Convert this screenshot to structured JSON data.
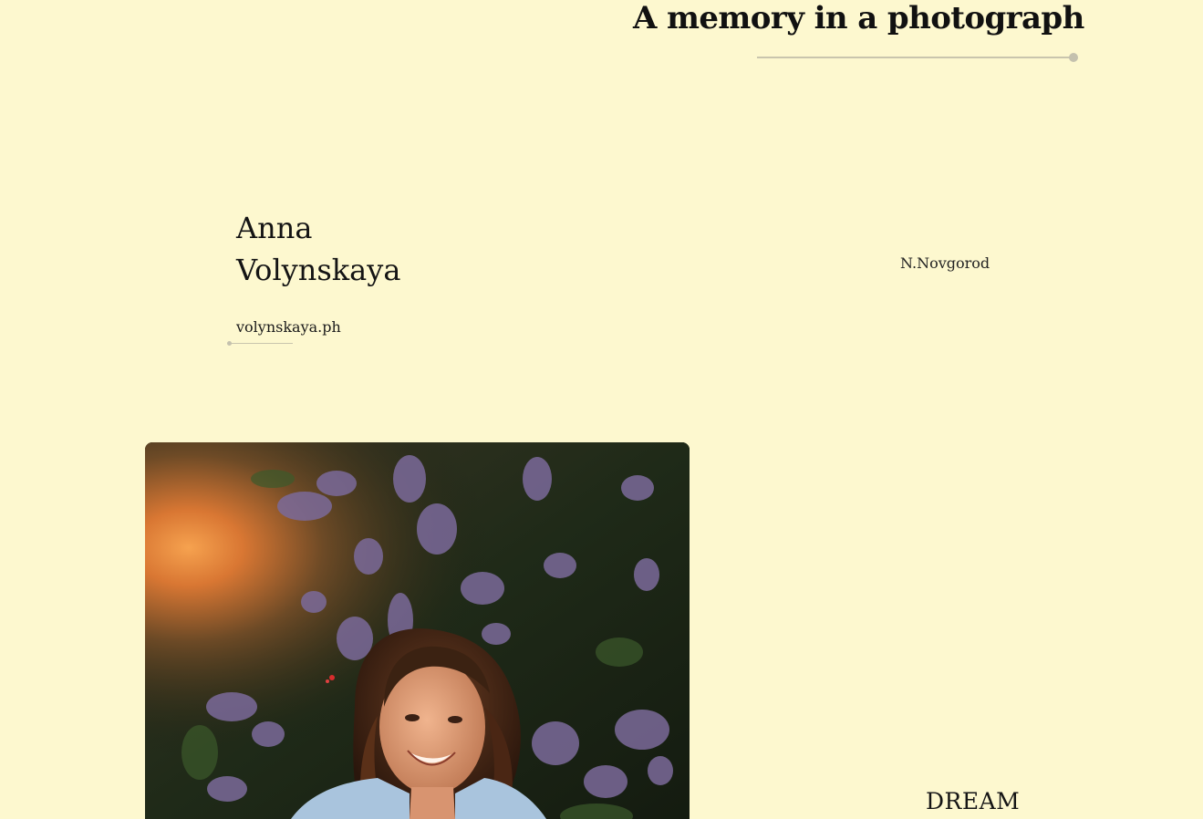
{
  "header": {
    "title": "A memory in a photograph"
  },
  "author": {
    "first_name": "Anna",
    "last_name": "Volynskaya",
    "handle": "volynskaya.ph",
    "city": "N.Novgorod"
  },
  "photo": {
    "icon": "portrait-photo"
  },
  "section": {
    "label": "DREAM"
  },
  "colors": {
    "background": "#fdf8cf",
    "text": "#141414",
    "accent_line": "#c9c5ad"
  }
}
